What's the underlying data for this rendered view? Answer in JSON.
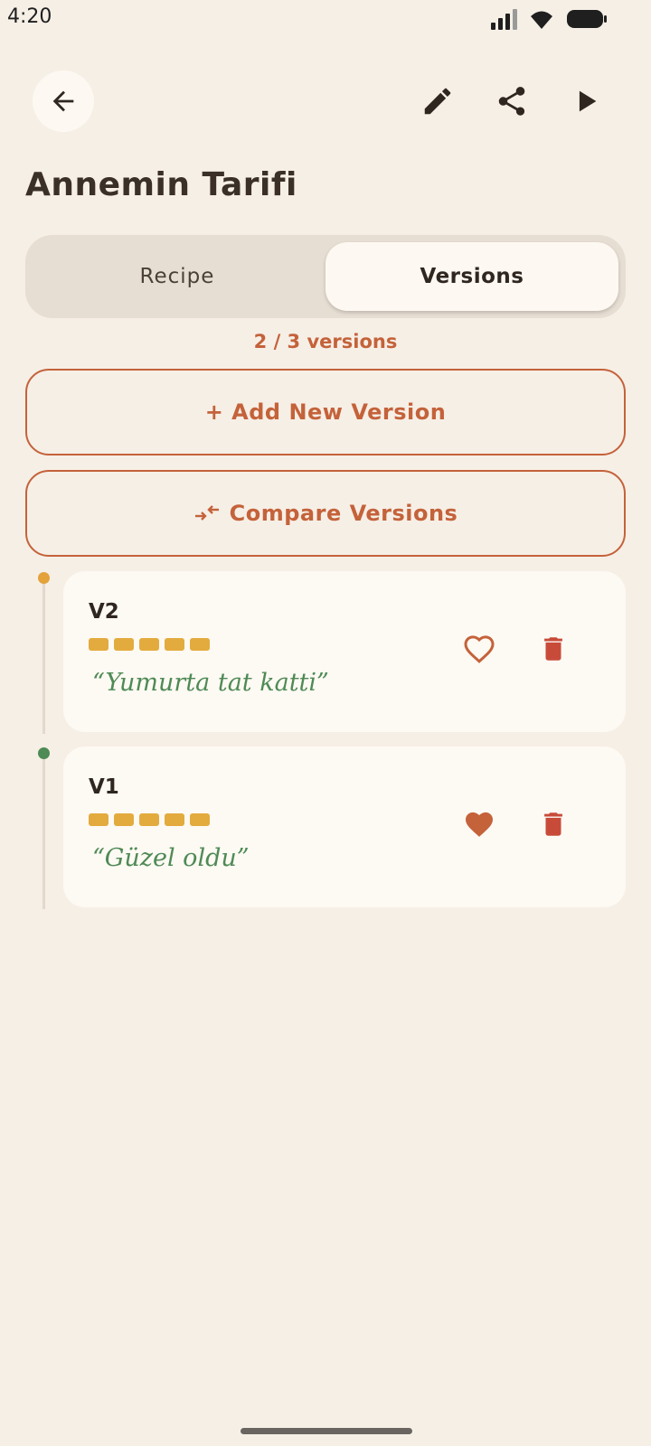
{
  "status_bar": {
    "time": "4:20"
  },
  "header": {
    "title": "Annemin Tarifi",
    "back_icon": "arrow-left-icon",
    "actions": [
      "pencil-icon",
      "share-icon",
      "play-icon"
    ]
  },
  "tabs": [
    {
      "label": "Recipe",
      "selected": false
    },
    {
      "label": "Versions",
      "selected": true
    }
  ],
  "version_count": "2 / 3 versions",
  "buttons": {
    "add_version": "+ Add New Version",
    "compare_versions": "Compare Versions"
  },
  "versions": [
    {
      "label": "V2",
      "rating": 5,
      "note": "“Yumurta tat katti”",
      "favorite": false,
      "dot_color": "#e3a23a"
    },
    {
      "label": "V1",
      "rating": 5,
      "note": "“Güzel oldu”",
      "favorite": true,
      "dot_color": "#4e8a55"
    }
  ],
  "colors": {
    "accent": "#c4623a",
    "background": "#f6efe6",
    "card": "#fdf9f3",
    "rating": "#e3ab3e",
    "note": "#4e8a55"
  }
}
